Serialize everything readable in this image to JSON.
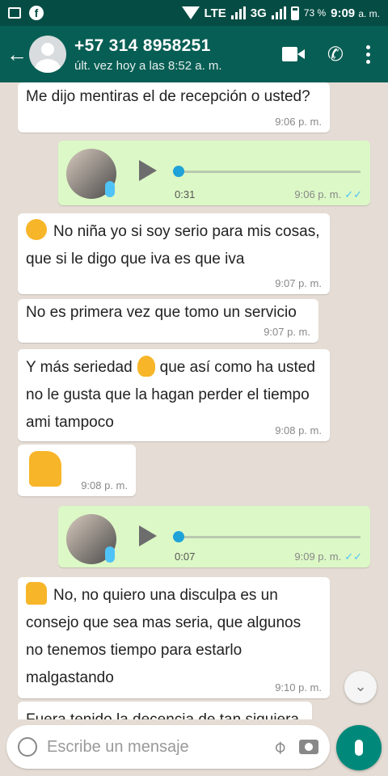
{
  "status_bar": {
    "network": "LTE",
    "network2": "3G",
    "battery": "73 %",
    "time": "9:09",
    "time_suffix": "a. m."
  },
  "header": {
    "contact_name": "+57 314 8958251",
    "last_seen": "últ. vez hoy a las 8:52 a. m."
  },
  "messages": [
    {
      "dir": "in",
      "text": "Me dijo mentiras el de recepción o usted?",
      "time": "9:06 p. m."
    },
    {
      "dir": "out",
      "type": "voice",
      "duration": "0:31",
      "time": "9:06 p. m.",
      "ticks": "✓✓",
      "played": 0.0
    },
    {
      "dir": "in",
      "text": "No niña yo si soy serio para mis cosas, que si le digo que iva es que iva",
      "time": "9:07 p. m."
    },
    {
      "dir": "in",
      "text": "No es primera vez que tomo un servicio",
      "time": "9:07 p. m."
    },
    {
      "dir": "in",
      "text_a": "Y más seriedad",
      "text_b": "que así como ha usted no le gusta que la hagan perder el tiempo ami tampoco",
      "time": "9:08 p. m."
    },
    {
      "dir": "in",
      "type": "emoji",
      "time": "9:08 p. m."
    },
    {
      "dir": "out",
      "type": "voice",
      "duration": "0:07",
      "time": "9:09 p. m.",
      "ticks": "✓✓",
      "played": 0.0
    },
    {
      "dir": "in",
      "text": "No, no quiero una disculpa es un consejo que sea mas seria, que algunos no tenemos tiempo para estarlo malgastando",
      "time": "9:10 p. m."
    },
    {
      "dir": "in",
      "text": "Fuera tenido la decencia de tan siquiera"
    }
  ],
  "input": {
    "placeholder": "Escribe un mensaje"
  },
  "colors": {
    "header": "#075e54",
    "status_bar": "#054d44",
    "outgoing_bubble": "#dcf8c6",
    "incoming_bubble": "#ffffff",
    "mic_button": "#00897b"
  },
  "icons": {
    "back": "arrow-left-icon",
    "video": "video-call-icon",
    "phone": "phone-icon",
    "menu": "more-vert-icon",
    "emoji": "emoji-icon",
    "attach": "paperclip-icon",
    "camera": "camera-icon",
    "mic": "microphone-icon",
    "scroll": "chevrons-down-icon"
  }
}
